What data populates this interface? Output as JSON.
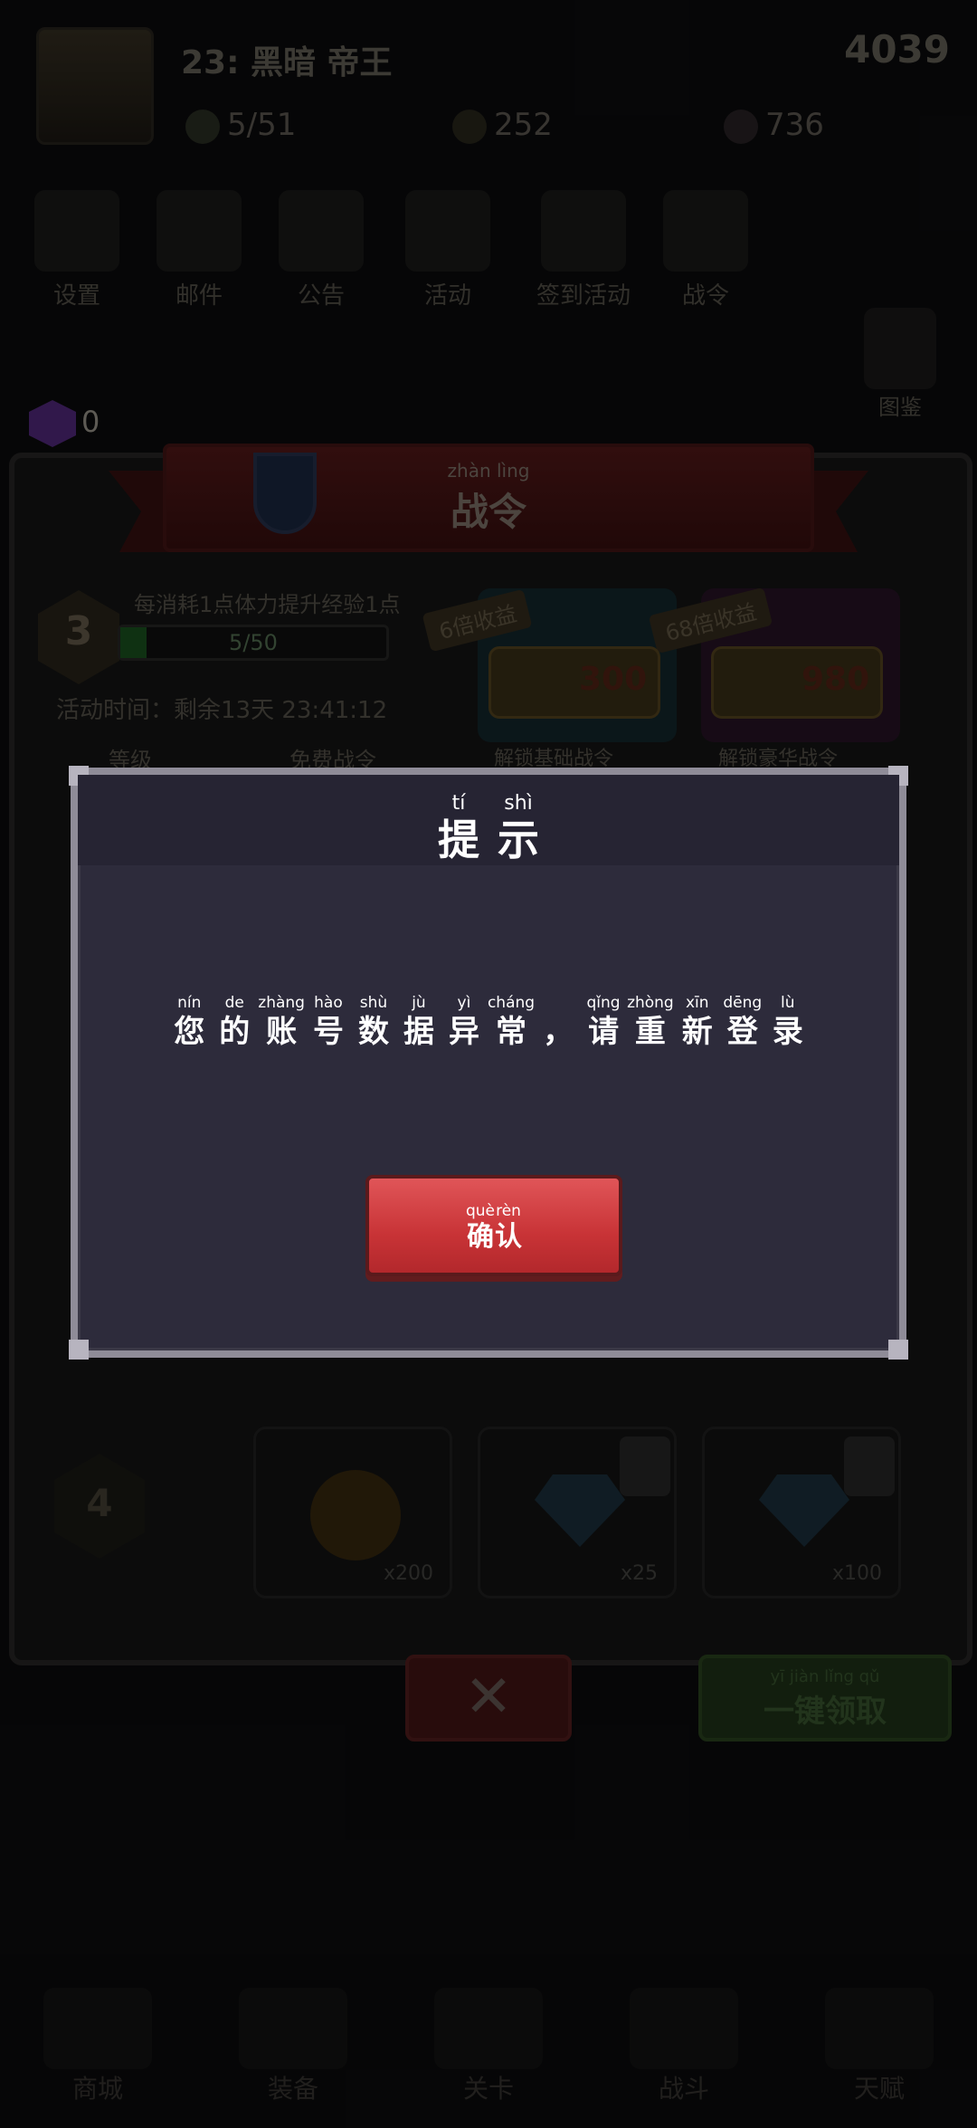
{
  "colors": {
    "modal_bg": "#2d2b3b",
    "modal_border": "#8f8c98",
    "confirm_button": "#c83336",
    "text": "#ffffff"
  },
  "background": {
    "player_header": "23:  黑暗  帝王",
    "score": "4039",
    "resources": {
      "stamina": "5/51",
      "coins": "252",
      "gems": "736"
    },
    "gem_count": "0",
    "menu_labels": [
      "设置",
      "邮件",
      "公告",
      "活动",
      "签到活动",
      "战令"
    ],
    "side_label": "图鉴",
    "battle_pass": {
      "title": {
        "pinyin": "zhàn lìng",
        "text": "战令"
      },
      "level": "3",
      "exp": "5/50",
      "exp_fraction": 0.1,
      "note": "每消耗1点体力提升经验1点",
      "time": "活动时间：剩余13天  23:41:12",
      "tier_tags": [
        "6倍收益",
        "68倍收益"
      ],
      "prices": [
        "300",
        "980"
      ],
      "columns": [
        "等级",
        "免费战令",
        "解锁基础战令",
        "解锁豪华战令"
      ],
      "row_level": "4",
      "quantities": [
        "x200",
        "x25",
        "x100"
      ]
    },
    "claim_button": {
      "pinyin": "yī jiàn lǐng qǔ",
      "text": "一键领取"
    },
    "close_icon": "close-x-icon",
    "nav_labels": [
      "商城",
      "装备",
      "关卡",
      "战斗",
      "天赋"
    ]
  },
  "dialog": {
    "title": [
      {
        "py": "tí",
        "hz": "提"
      },
      {
        "py": "shì",
        "hz": "示"
      }
    ],
    "message": [
      {
        "py": "nín",
        "hz": "您"
      },
      {
        "py": "de",
        "hz": "的"
      },
      {
        "py": "zhàng",
        "hz": "账"
      },
      {
        "py": "hào",
        "hz": "号"
      },
      {
        "py": "shù",
        "hz": "数"
      },
      {
        "py": "jù",
        "hz": "据"
      },
      {
        "py": "yì",
        "hz": "异"
      },
      {
        "py": "cháng",
        "hz": "常"
      },
      {
        "py": "",
        "hz": "，"
      },
      {
        "py": "qǐng",
        "hz": "请"
      },
      {
        "py": "zhòng",
        "hz": "重"
      },
      {
        "py": "xīn",
        "hz": "新"
      },
      {
        "py": "dēng",
        "hz": "登"
      },
      {
        "py": "lù",
        "hz": "录"
      }
    ],
    "confirm": [
      {
        "py": "què",
        "hz": "确"
      },
      {
        "py": "rèn",
        "hz": "认"
      }
    ]
  }
}
